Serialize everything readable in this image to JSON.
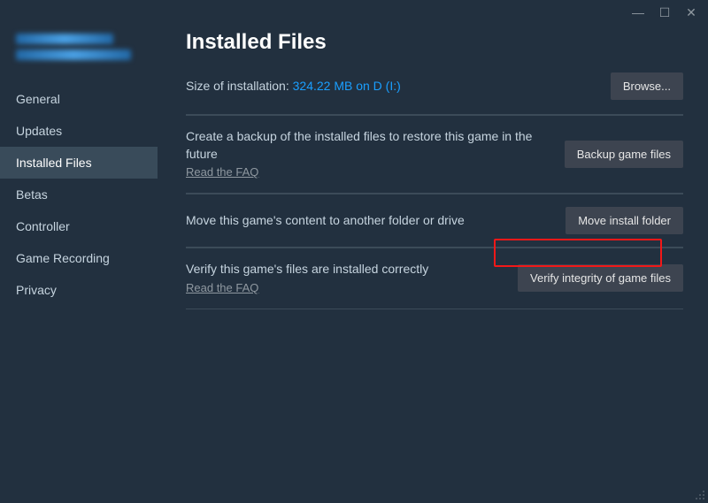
{
  "titlebar": {
    "minimize": "—",
    "maximize": "☐",
    "close": "✕"
  },
  "sidebar": {
    "items": [
      {
        "label": "General"
      },
      {
        "label": "Updates"
      },
      {
        "label": "Installed Files"
      },
      {
        "label": "Betas"
      },
      {
        "label": "Controller"
      },
      {
        "label": "Game Recording"
      },
      {
        "label": "Privacy"
      }
    ]
  },
  "main": {
    "title": "Installed Files",
    "size_label": "Size of installation: ",
    "size_value": "324.22 MB on D (I:)",
    "browse_label": "Browse...",
    "backup": {
      "text": "Create a backup of the installed files to restore this game in the future",
      "faq": "Read the FAQ",
      "button": "Backup game files"
    },
    "move": {
      "text": "Move this game's content to another folder or drive",
      "button": "Move install folder"
    },
    "verify": {
      "text": "Verify this game's files are installed correctly",
      "faq": "Read the FAQ",
      "button": "Verify integrity of game files"
    }
  }
}
